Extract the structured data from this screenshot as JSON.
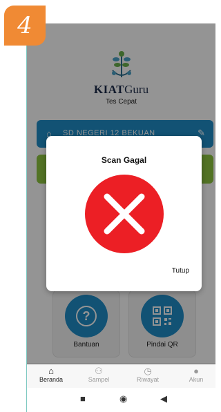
{
  "step_badge": "4",
  "app": {
    "brand_bold": "KIAT",
    "brand_rest": "Guru",
    "subtitle": "Tes Cepat"
  },
  "school_bar": {
    "label": "SD NEGERI 12 BEKUAN",
    "color": "#1f8ec9"
  },
  "green_bar": {
    "color": "#8dc63f"
  },
  "cards": [
    {
      "label": "Bantuan",
      "icon": "help-icon"
    },
    {
      "label": "Pindai QR",
      "icon": "qr-code-icon"
    }
  ],
  "bottom_nav": [
    {
      "label": "Beranda",
      "icon": "home-icon",
      "active": true
    },
    {
      "label": "Sampel",
      "icon": "people-icon",
      "active": false
    },
    {
      "label": "Riwayat",
      "icon": "history-icon",
      "active": false
    },
    {
      "label": "Akun",
      "icon": "account-icon",
      "active": false
    }
  ],
  "system_nav": {
    "icons": [
      "recents-square-icon",
      "home-circle-icon",
      "back-triangle-icon"
    ]
  },
  "dialog": {
    "title": "Scan Gagal",
    "icon": "error-x-icon",
    "icon_color": "#ec1f25",
    "close_label": "Tutup"
  },
  "accent_badge_color": "#f08a34"
}
